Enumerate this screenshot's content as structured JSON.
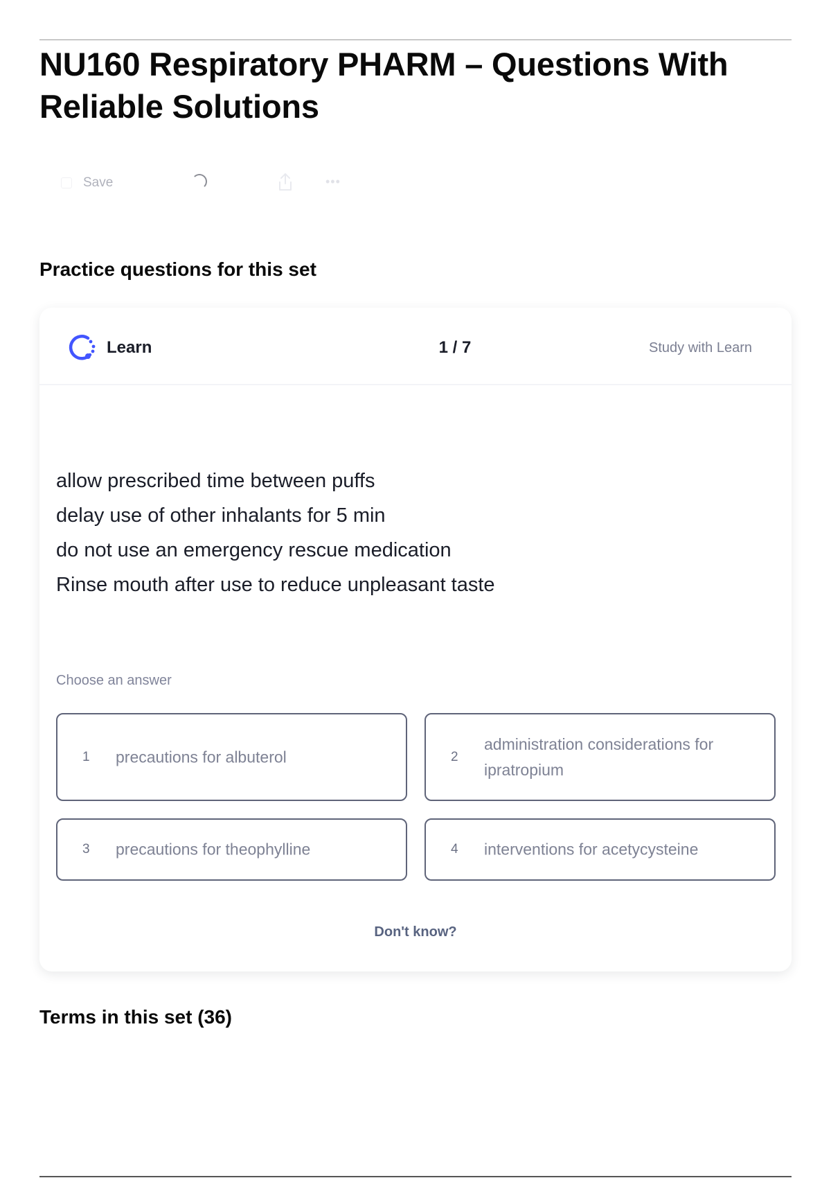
{
  "page": {
    "title": "NU160 Respiratory PHARM – Questions With Reliable Solutions"
  },
  "toolbar": {
    "save_label": "Save",
    "icons": [
      "checkbox-icon",
      "spinner-icon",
      "share-icon",
      "more-icon"
    ]
  },
  "practice": {
    "heading": "Practice questions for this set",
    "mode_label": "Learn",
    "progress": "1 / 7",
    "study_link": "Study with Learn",
    "prompt_lines": [
      "allow prescribed time between puffs",
      "delay use of other inhalants for 5 min",
      "do not use an emergency rescue medication",
      "Rinse mouth after use to reduce unpleasant taste"
    ],
    "choose_label": "Choose an answer",
    "answers": [
      {
        "number": "1",
        "text": "precautions for albuterol"
      },
      {
        "number": "2",
        "text": "administration considerations for ipratropium"
      },
      {
        "number": "3",
        "text": "precautions for theophylline"
      },
      {
        "number": "4",
        "text": "interventions for acetycysteine"
      }
    ],
    "dont_know": "Don't know?"
  },
  "terms": {
    "heading": "Terms in this set (36)"
  },
  "colors": {
    "learn_icon": "#4255ff",
    "answer_border": "#5f6479",
    "dont_know": "#586380"
  }
}
